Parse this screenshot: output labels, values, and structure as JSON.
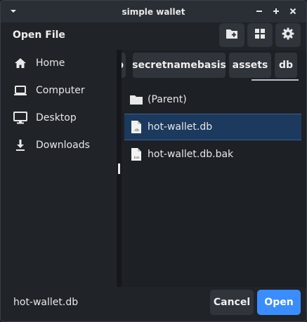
{
  "window": {
    "title": "simple wallet",
    "icons": {
      "menu": "chevron-down-icon",
      "minimize": "minimize-icon",
      "maximize": "maximize-icon",
      "close": "close-icon"
    }
  },
  "header": {
    "label": "Open File",
    "buttons": [
      {
        "name": "new-folder-button",
        "icon": "folder-plus-icon"
      },
      {
        "name": "view-toggle-button",
        "icon": "grid-icon"
      },
      {
        "name": "settings-button",
        "icon": "gear-icon"
      }
    ]
  },
  "sidebar": {
    "items": [
      {
        "label": "Home",
        "icon": "home-icon"
      },
      {
        "label": "Computer",
        "icon": "laptop-icon"
      },
      {
        "label": "Desktop",
        "icon": "monitor-icon"
      },
      {
        "label": "Downloads",
        "icon": "download-icon"
      }
    ]
  },
  "breadcrumbs": {
    "items": [
      "b",
      "secretnamebasis",
      "assets",
      "db"
    ],
    "active": "db"
  },
  "files": {
    "items": [
      {
        "label": "(Parent)",
        "icon": "folder-icon",
        "selected": false
      },
      {
        "label": "hot-wallet.db",
        "icon": "file-db-icon",
        "badge": ".db",
        "selected": true
      },
      {
        "label": "hot-wallet.db.bak",
        "icon": "file-bak-icon",
        "badge": ".bak",
        "selected": false
      }
    ]
  },
  "footer": {
    "filename": "hot-wallet.db",
    "cancel_label": "Cancel",
    "open_label": "Open"
  },
  "colors": {
    "accent": "#3a8dff",
    "selection": "#1c3a5e",
    "background": "#22262c"
  }
}
